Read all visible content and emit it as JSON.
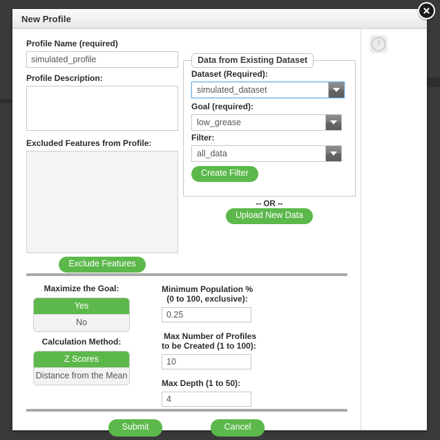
{
  "window": {
    "title": "New Profile",
    "close_icon": "close-icon",
    "help_icon": "question-mark-icon"
  },
  "left_panel": {
    "profile_name_label": "Profile Name (required)",
    "profile_name_value": "simulated_profile",
    "profile_name_placeholder": "",
    "profile_description_label": "Profile Description:",
    "profile_description_value": "",
    "profile_description_placeholder": "",
    "excluded_features_label": "Excluded Features from Profile:",
    "excluded_features_items": [],
    "exclude_features_button": "Exclude Features"
  },
  "dataset_panel": {
    "legend": "Data from Existing Dataset",
    "dataset_label": "Dataset (Required):",
    "dataset_value": "simulated_dataset",
    "goal_label": "Goal (required):",
    "goal_value": "low_grease",
    "filter_label": "Filter:",
    "filter_value": "all_data",
    "create_filter_button": "Create Filter",
    "or_divider": "-- OR --",
    "upload_button": "Upload New Data",
    "dropdown_arrow_icon": "chevron-down-icon"
  },
  "options": {
    "maximize_goal_label": "Maximize the Goal:",
    "maximize_goal_yes": "Yes",
    "maximize_goal_no": "No",
    "maximize_goal_selected": "Yes",
    "calculation_method_label": "Calculation Method:",
    "calculation_method_z": "Z Scores",
    "calculation_method_dist": "Distance from the Mean",
    "calculation_method_selected": "Z Scores"
  },
  "numeric": {
    "min_population_label_line1": "Minimum Population %",
    "min_population_label_line2": "(0 to 100, exclusive):",
    "min_population_value": "0.25",
    "max_profiles_label_line1": "Max Number of Profiles",
    "max_profiles_label_line2": "to be Created (1 to 100):",
    "max_profiles_value": "10",
    "max_depth_label": "Max Depth (1 to 50):",
    "max_depth_value": "4"
  },
  "footer": {
    "submit_button": "Submit",
    "cancel_button": "Cancel"
  },
  "colors": {
    "accent_green": "#5cb84b",
    "backdrop": "#3a3a3a",
    "titlebar": "#efefef",
    "focus_blue": "#6aa9e0",
    "divider_gray": "#a9a9a9"
  }
}
